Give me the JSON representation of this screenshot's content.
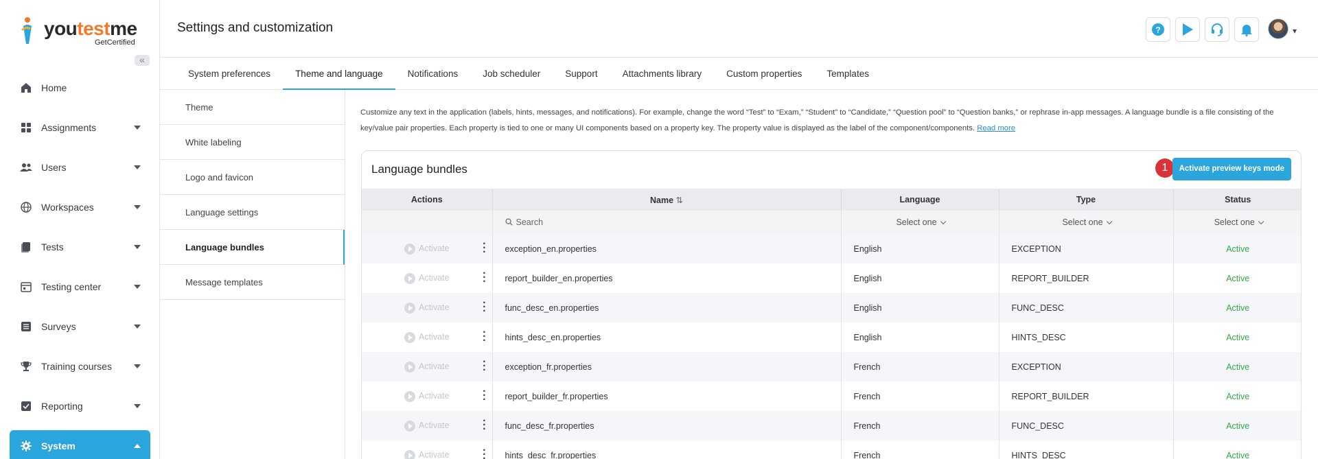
{
  "brand": {
    "logo_main_a": "you",
    "logo_main_b": "test",
    "logo_main_c": "me",
    "logo_sub": "GetCertified"
  },
  "sidebar": {
    "items": [
      {
        "label": "Home",
        "icon": "home-icon",
        "expandable": false,
        "active": false
      },
      {
        "label": "Assignments",
        "icon": "assignments-icon",
        "expandable": true,
        "active": false
      },
      {
        "label": "Users",
        "icon": "users-icon",
        "expandable": true,
        "active": false
      },
      {
        "label": "Workspaces",
        "icon": "globe-icon",
        "expandable": true,
        "active": false
      },
      {
        "label": "Tests",
        "icon": "tests-icon",
        "expandable": true,
        "active": false
      },
      {
        "label": "Testing center",
        "icon": "calendar-icon",
        "expandable": true,
        "active": false
      },
      {
        "label": "Surveys",
        "icon": "list-icon",
        "expandable": true,
        "active": false
      },
      {
        "label": "Training courses",
        "icon": "trophy-icon",
        "expandable": true,
        "active": false
      },
      {
        "label": "Reporting",
        "icon": "report-icon",
        "expandable": true,
        "active": false
      },
      {
        "label": "System",
        "icon": "gear-icon",
        "expandable": true,
        "active": true
      }
    ]
  },
  "header": {
    "title": "Settings and customization"
  },
  "tabs": [
    "System preferences",
    "Theme and language",
    "Notifications",
    "Job scheduler",
    "Support",
    "Attachments library",
    "Custom properties",
    "Templates"
  ],
  "active_tab": "Theme and language",
  "subnav": [
    "Theme",
    "White labeling",
    "Logo and favicon",
    "Language settings",
    "Language bundles",
    "Message templates"
  ],
  "active_subnav": "Language bundles",
  "description": {
    "text": "Customize any text in the application (labels, hints, messages, and notifications). For example, change the word “Test” to “Exam,” “Student” to “Candidate,” “Question pool” to “Question banks,” or rephrase in-app messages. A language bundle is a file consisting of the key/value pair properties. Each property is tied to one or many UI components based on a property key. The property value is displayed as the label of the component/components.",
    "link": "Read more"
  },
  "card": {
    "title": "Language bundles",
    "preview_button": "Activate preview keys mode",
    "step_badge": "1"
  },
  "table": {
    "headers": {
      "actions": "Actions",
      "name": "Name",
      "language": "Language",
      "type": "Type",
      "status": "Status"
    },
    "filters": {
      "search_placeholder": "Search",
      "language": "Select one",
      "type": "Select one",
      "status": "Select one"
    },
    "action_label": "Activate",
    "rows": [
      {
        "name": "exception_en.properties",
        "language": "English",
        "type": "EXCEPTION",
        "status": "Active"
      },
      {
        "name": "report_builder_en.properties",
        "language": "English",
        "type": "REPORT_BUILDER",
        "status": "Active"
      },
      {
        "name": "func_desc_en.properties",
        "language": "English",
        "type": "FUNC_DESC",
        "status": "Active"
      },
      {
        "name": "hints_desc_en.properties",
        "language": "English",
        "type": "HINTS_DESC",
        "status": "Active"
      },
      {
        "name": "exception_fr.properties",
        "language": "French",
        "type": "EXCEPTION",
        "status": "Active"
      },
      {
        "name": "report_builder_fr.properties",
        "language": "French",
        "type": "REPORT_BUILDER",
        "status": "Active"
      },
      {
        "name": "func_desc_fr.properties",
        "language": "French",
        "type": "FUNC_DESC",
        "status": "Active"
      },
      {
        "name": "hints_desc_fr.properties",
        "language": "French",
        "type": "HINTS_DESC",
        "status": "Active"
      }
    ]
  },
  "colors": {
    "accent": "#2ba6dd",
    "active_status": "#35a64a",
    "badge": "#d8333b",
    "logo_accent": "#f07a2a"
  }
}
